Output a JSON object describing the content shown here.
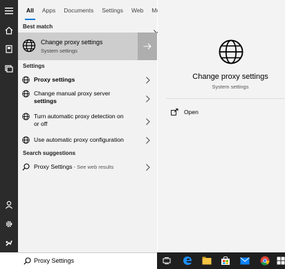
{
  "tabs": [
    "All",
    "Apps",
    "Documents",
    "Settings",
    "Web",
    "More"
  ],
  "sections": {
    "best_match": "Best match",
    "settings": "Settings",
    "suggestions": "Search suggestions"
  },
  "best_match": {
    "title": "Change proxy settings",
    "subtitle": "System settings"
  },
  "settings_items": [
    {
      "line1": "Proxy settings",
      "line2": ""
    },
    {
      "line1": "Change manual proxy server",
      "line2": "settings"
    },
    {
      "line1": "Turn automatic proxy detection on",
      "line2": "or off"
    },
    {
      "line1": "Use automatic proxy configuration",
      "line2": ""
    }
  ],
  "suggestion": {
    "text": "Proxy Settings",
    "note": " - See web results"
  },
  "search": {
    "value": "Proxy Settings"
  },
  "preview": {
    "title": "Change proxy settings",
    "subtitle": "System settings",
    "open_label": "Open"
  },
  "colors": {
    "accent": "#0078d7",
    "rail": "#2b2b2b",
    "taskbar": "#1f1f1f",
    "selected": "#cdcdcd"
  }
}
